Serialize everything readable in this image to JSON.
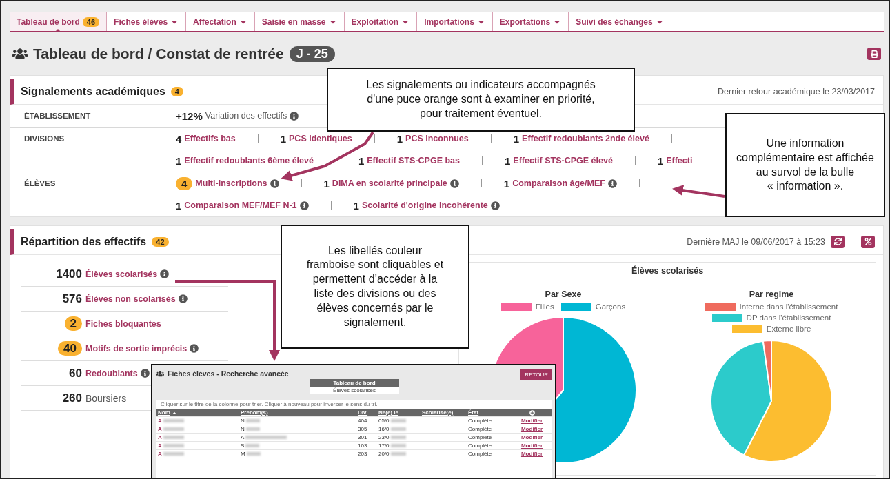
{
  "nav": {
    "tabs": [
      {
        "label": "Tableau de bord",
        "badge": "46",
        "dropdown": false,
        "selected": true
      },
      {
        "label": "Fiches élèves",
        "dropdown": true,
        "selected": false
      },
      {
        "label": "Affectation",
        "dropdown": true,
        "selected": false
      },
      {
        "label": "Saisie en masse",
        "dropdown": true,
        "selected": false
      },
      {
        "label": "Exploitation",
        "dropdown": true,
        "selected": false
      },
      {
        "label": "Importations",
        "dropdown": true,
        "selected": false
      },
      {
        "label": "Exportations",
        "dropdown": true,
        "selected": false
      },
      {
        "label": "Suivi des échanges",
        "dropdown": true,
        "selected": false
      }
    ]
  },
  "page": {
    "title": "Tableau de bord / Constat de rentrée",
    "badge": "J - 25"
  },
  "signalements": {
    "title": "Signalements académiques",
    "badge": "4",
    "last_return": "Dernier retour académique le 23/03/2017",
    "rows": [
      {
        "label": "ÉTABLISSEMENT",
        "lines": [
          [
            {
              "count": "+12%",
              "label": "Variation des effectifs",
              "kind": "plain",
              "info": true,
              "flagged": false
            }
          ]
        ]
      },
      {
        "label": "DIVISIONS",
        "lines": [
          [
            {
              "count": "4",
              "label": "Effectifs bas",
              "kind": "link",
              "info": false,
              "flagged": false
            },
            {
              "count": "1",
              "label": "PCS identiques",
              "kind": "link",
              "info": false,
              "flagged": false
            },
            {
              "count": "1",
              "label": "PCS inconnues",
              "kind": "link",
              "info": false,
              "flagged": false
            },
            {
              "count": "1",
              "label": "Effectif redoublants 2nde élevé",
              "kind": "link",
              "info": false,
              "flagged": false
            }
          ],
          [
            {
              "count": "1",
              "label": "Effectif redoublants 6ème élevé",
              "kind": "link",
              "info": false,
              "flagged": false
            },
            {
              "count": "1",
              "label": "Effectif STS-CPGE bas",
              "kind": "link",
              "info": false,
              "flagged": false
            },
            {
              "count": "1",
              "label": "Effectif STS-CPGE élevé",
              "kind": "link",
              "info": false,
              "flagged": false
            },
            {
              "count": "1",
              "label": "Effecti",
              "kind": "link",
              "info": false,
              "flagged": false
            }
          ]
        ]
      },
      {
        "label": "ÉLÈVES",
        "lines": [
          [
            {
              "count": "4",
              "label": "Multi-inscriptions",
              "kind": "link",
              "info": true,
              "flagged": true
            },
            {
              "count": "1",
              "label": "DIMA en scolarité principale",
              "kind": "link",
              "info": true,
              "flagged": false
            },
            {
              "count": "1",
              "label": "Comparaison âge/MEF",
              "kind": "link",
              "info": true,
              "flagged": false
            }
          ],
          [
            {
              "count": "1",
              "label": "Comparaison MEF/MEF N-1",
              "kind": "link",
              "info": true,
              "flagged": false
            },
            {
              "count": "1",
              "label": "Scolarité d'origine incohérente",
              "kind": "link",
              "info": true,
              "flagged": false
            }
          ]
        ]
      }
    ]
  },
  "repartition": {
    "title": "Répartition des effectifs",
    "badge": "42",
    "last_update": "Dernière MAJ le 09/06/2017 à 15:23",
    "stats": [
      {
        "count": "1400",
        "label": "Élèves scolarisés",
        "kind": "link",
        "info": true,
        "flagged": false
      },
      {
        "count": "576",
        "label": "Élèves non scolarisés",
        "kind": "link",
        "info": true,
        "flagged": false
      },
      {
        "count": "2",
        "label": "Fiches bloquantes",
        "kind": "link",
        "info": false,
        "flagged": true
      },
      {
        "count": "40",
        "label": "Motifs de sortie imprécis",
        "kind": "link",
        "info": true,
        "flagged": true
      },
      {
        "count": "60",
        "label": "Redoublants",
        "kind": "link",
        "info": true,
        "flagged": false
      },
      {
        "count": "260",
        "label": "Boursiers",
        "kind": "plain",
        "info": false,
        "flagged": false
      }
    ],
    "chart_card": {
      "title": "Élèves scolarisés",
      "charts": [
        {
          "title": "Par Sexe",
          "legend": [
            {
              "label": "Filles",
              "color": "#f7639a"
            },
            {
              "label": "Garçons",
              "color": "#00b7d4"
            }
          ]
        },
        {
          "title": "Par regime",
          "legend": [
            {
              "label": "Interne dans l'établissement",
              "color": "#ef6b5e"
            },
            {
              "label": "DP dans l'établissement",
              "color": "#2ccbcb"
            },
            {
              "label": "Externe libre",
              "color": "#fcbd30"
            }
          ]
        }
      ]
    }
  },
  "inset": {
    "title": "Fiches élèves - Recherche avancée",
    "button": "RETOUR",
    "crumb_title": "Tableau de bord",
    "crumb_value": "Élèves scolarisés",
    "hint": "Cliquer sur le titre de la colonne pour trier. Cliquer à nouveau pour inverser le sens du tri.",
    "columns": [
      "Nom",
      "Prénom(s)",
      "Div.",
      "Né(e) le",
      "Scolarisé(e)",
      "État"
    ],
    "rows": [
      {
        "nom": "A",
        "prenom": "N",
        "div": "404",
        "date": "05/0",
        "etat": "Complète",
        "action": "Modifier"
      },
      {
        "nom": "A",
        "prenom": "N",
        "div": "305",
        "date": "16/0",
        "etat": "Complète",
        "action": "Modifier"
      },
      {
        "nom": "A",
        "prenom": "A",
        "div": "301",
        "date": "23/0",
        "etat": "Complète",
        "action": "Modifier"
      },
      {
        "nom": "A",
        "prenom": "S",
        "div": "103",
        "date": "17/0",
        "etat": "Complète",
        "action": "Modifier"
      },
      {
        "nom": "A",
        "prenom": "M",
        "div": "203",
        "date": "20/0",
        "etat": "Complète",
        "action": "Modifier"
      }
    ]
  },
  "callouts": [
    {
      "text": "Les signalements ou indicateurs accompagnés d'une puce orange sont à examiner en priorité, pour traitement éventuel."
    },
    {
      "text": "Une information complémentaire est affichée au survol de la bulle\n« information »."
    },
    {
      "text": "Les libellés couleur framboise sont cliquables et permettent d’accéder à la liste des divisions ou des élèves concernés par le signalement."
    }
  ]
}
